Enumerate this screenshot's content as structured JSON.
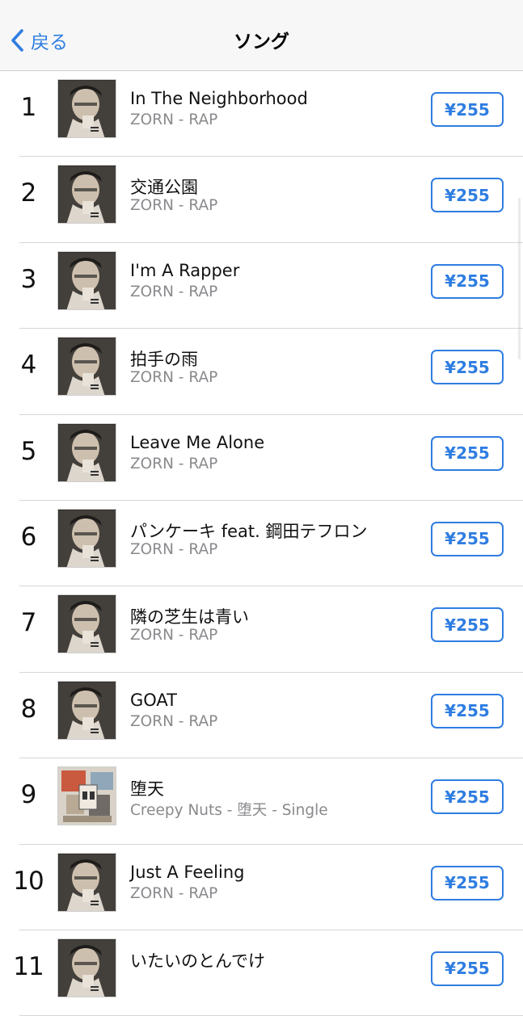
{
  "nav": {
    "back_label": "戻る",
    "title": "ソング"
  },
  "songs": [
    {
      "rank": "1",
      "title": "In The Neighborhood",
      "subtitle": "ZORN - RAP",
      "price": "¥255",
      "art": "zorn-rap"
    },
    {
      "rank": "2",
      "title": "交通公園",
      "subtitle": "ZORN - RAP",
      "price": "¥255",
      "art": "zorn-rap"
    },
    {
      "rank": "3",
      "title": "I'm A Rapper",
      "subtitle": "ZORN - RAP",
      "price": "¥255",
      "art": "zorn-rap"
    },
    {
      "rank": "4",
      "title": "拍手の雨",
      "subtitle": "ZORN - RAP",
      "price": "¥255",
      "art": "zorn-rap"
    },
    {
      "rank": "5",
      "title": "Leave Me Alone",
      "subtitle": "ZORN - RAP",
      "price": "¥255",
      "art": "zorn-rap"
    },
    {
      "rank": "6",
      "title": "パンケーキ feat. 鋼田テフロン",
      "subtitle": "ZORN - RAP",
      "price": "¥255",
      "art": "zorn-rap"
    },
    {
      "rank": "7",
      "title": "隣の芝生は青い",
      "subtitle": "ZORN - RAP",
      "price": "¥255",
      "art": "zorn-rap"
    },
    {
      "rank": "8",
      "title": "GOAT",
      "subtitle": "ZORN - RAP",
      "price": "¥255",
      "art": "zorn-rap"
    },
    {
      "rank": "9",
      "title": "堕天",
      "subtitle": "Creepy Nuts - 堕天 - Single",
      "price": "¥255",
      "art": "creepy-nuts-single"
    },
    {
      "rank": "10",
      "title": "Just A Feeling",
      "subtitle": "ZORN - RAP",
      "price": "¥255",
      "art": "zorn-rap"
    },
    {
      "rank": "11",
      "title": "いたいのとんでけ",
      "subtitle": "",
      "price": "¥255",
      "art": "zorn-rap"
    }
  ],
  "colors": {
    "accent": "#2f7de1",
    "subtitle": "#8a8a8e",
    "navbar_bg": "#f7f7f7"
  }
}
